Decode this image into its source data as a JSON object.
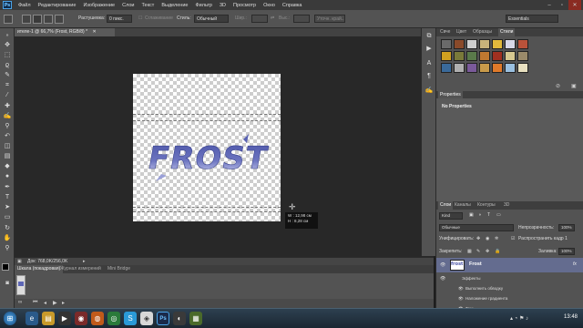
{
  "menubar": {
    "logo": "Ps",
    "items": [
      "Файл",
      "Редактирование",
      "Изображение",
      "Слои",
      "Текст",
      "Выделение",
      "Фильтр",
      "3D",
      "Просмотр",
      "Окно",
      "Справка"
    ]
  },
  "options": {
    "feather_label": "Растушевка:",
    "feather_value": "0 пикс.",
    "antialias_label": "Сглаживание",
    "style_label": "Стиль:",
    "style_value": "Обычный",
    "width_label": "Шир.:",
    "height_label": "Выс.:",
    "refine_label": "Уточн. край...",
    "workspace": "Essentials"
  },
  "document": {
    "tab_label": "ителе-1 @ 66,7% (Frost, RGB/8) *",
    "art_text": "FROST",
    "status": "Док: 768,0K/256,0K",
    "dim_w_label": "W :",
    "dim_w_value": "12,98 см",
    "dim_h_label": "H :",
    "dim_h_value": "8,28 см"
  },
  "bottom_tabs": [
    "Шкала (покадровая)",
    "Журнал измерений",
    "Mini Bridge"
  ],
  "styles_panel": {
    "tabs": [
      "Свче",
      "Цвет",
      "Образцы",
      "Стили"
    ],
    "active_tab": "Стили"
  },
  "properties": {
    "title": "Properties",
    "empty": "No Properties"
  },
  "layers_panel": {
    "tabs": [
      "Слои",
      "Каналы",
      "Контуры",
      "3D"
    ],
    "kind": "Kind",
    "blend_mode": "Обычные",
    "opacity_label": "Непрозрачность:",
    "opacity_value": "100%",
    "unify_label": "Унифицировать:",
    "propagate_label": "Распространить кадр 1",
    "lock_label": "Закрепить:",
    "fill_label": "Заливка:",
    "fill_value": "100%",
    "layer_name": "Frost",
    "layer_thumb": "frost",
    "fx_badge": "fx",
    "effects_label": "Эффекты",
    "effects": [
      "Выполнить обводку",
      "Наложение градиента",
      "Тень"
    ]
  },
  "taskbar": {
    "clock": "13:48"
  },
  "colors": {
    "art_top": "#4b55a8",
    "art_bottom": "#c9cdf0",
    "selected_layer": "#646c8f",
    "ps_blue": "#4aa3e8"
  }
}
